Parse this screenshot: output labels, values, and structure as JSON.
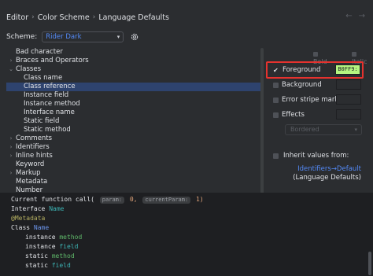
{
  "breadcrumb": [
    "Editor",
    "Color Scheme",
    "Language Defaults"
  ],
  "scheme": {
    "label": "Scheme:",
    "value": "Rider Dark"
  },
  "tree": [
    {
      "label": "Bad character",
      "depth": 0,
      "arrow": ""
    },
    {
      "label": "Braces and Operators",
      "depth": 0,
      "arrow": "›"
    },
    {
      "label": "Classes",
      "depth": 0,
      "arrow": "⌄"
    },
    {
      "label": "Class name",
      "depth": 1,
      "arrow": ""
    },
    {
      "label": "Class reference",
      "depth": 1,
      "arrow": "",
      "selected": true
    },
    {
      "label": "Instance field",
      "depth": 1,
      "arrow": ""
    },
    {
      "label": "Instance method",
      "depth": 1,
      "arrow": ""
    },
    {
      "label": "Interface name",
      "depth": 1,
      "arrow": ""
    },
    {
      "label": "Static field",
      "depth": 1,
      "arrow": ""
    },
    {
      "label": "Static method",
      "depth": 1,
      "arrow": ""
    },
    {
      "label": "Comments",
      "depth": 0,
      "arrow": "›"
    },
    {
      "label": "Identifiers",
      "depth": 0,
      "arrow": "›"
    },
    {
      "label": "Inline hints",
      "depth": 0,
      "arrow": "›"
    },
    {
      "label": "Keyword",
      "depth": 0,
      "arrow": ""
    },
    {
      "label": "Markup",
      "depth": 0,
      "arrow": "›"
    },
    {
      "label": "Metadata",
      "depth": 0,
      "arrow": ""
    },
    {
      "label": "Number",
      "depth": 0,
      "arrow": ""
    }
  ],
  "options": {
    "bold": "Bold",
    "italic": "Italic",
    "foreground": "Foreground",
    "foreground_value": "B0FF9:",
    "background": "Background",
    "error_stripe": "Error stripe mark",
    "effects": "Effects",
    "effects_style": "Bordered",
    "inherit": "Inherit values from:",
    "inherit_link": "Identifiers→Default",
    "inherit_source": "(Language Defaults)"
  },
  "colors": {
    "foreground_swatch": "#b5f580",
    "highlight_border": "#e5322e",
    "link": "#548af7"
  },
  "code": {
    "line1_a": "Current function call(",
    "line1_hint1": "param:",
    "line1_num": "0,",
    "line1_hint2": "currentParam:",
    "line1_num2": "1)",
    "line2_kw": "Interface",
    "line2_name": "Name",
    "line3": "@Metadata",
    "line4_kw": "Class",
    "line4_name": "Name",
    "line5_kw": "instance",
    "line5_name": "method",
    "line6_kw": "instance",
    "line6_name": "field",
    "line7_kw": "static",
    "line7_name": "method",
    "line8_kw": "static",
    "line8_name": "field"
  }
}
